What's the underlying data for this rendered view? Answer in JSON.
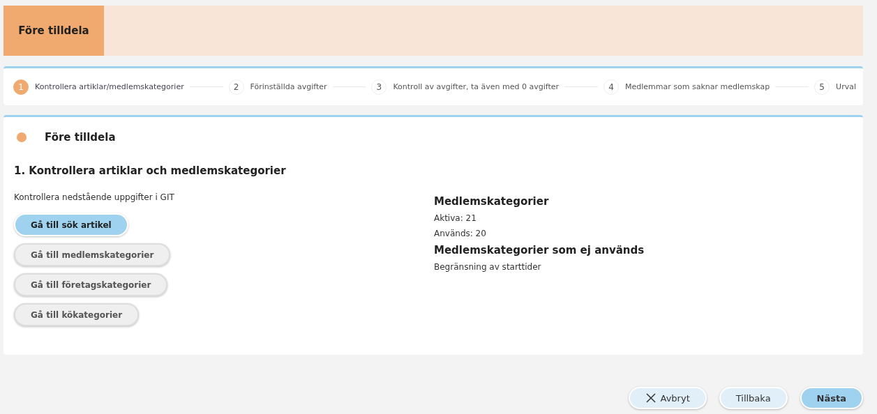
{
  "header": {
    "title": "Före tilldela"
  },
  "steps": [
    {
      "number": "1",
      "label": "Kontrollera artiklar/medlemskategorier",
      "selected": true
    },
    {
      "number": "2",
      "label": "Förinställda avgifter",
      "selected": false
    },
    {
      "number": "3",
      "label": "Kontroll av avgifter, ta även med 0 avgifter",
      "selected": false
    },
    {
      "number": "4",
      "label": "Medlemmar som saknar medlemskap",
      "selected": false
    },
    {
      "number": "5",
      "label": "Urval",
      "selected": false
    }
  ],
  "section": {
    "title": "Före tilldela",
    "heading": "1. Kontrollera artiklar och medlemskategorier",
    "intro": "Kontrollera nedstående uppgifter i GIT",
    "buttons": [
      {
        "label": "Gå till sök artikel",
        "kind": "primary"
      },
      {
        "label": "Gå till medlemskategorier",
        "kind": "secondary"
      },
      {
        "label": "Gå till företagskategorier",
        "kind": "secondary"
      },
      {
        "label": "Gå till kökategorier",
        "kind": "secondary"
      }
    ],
    "info": [
      {
        "kind": "heading",
        "text": "Medlemskategorier"
      },
      {
        "kind": "text",
        "text": "Aktiva: 21"
      },
      {
        "kind": "text",
        "text": "Används: 20"
      },
      {
        "kind": "heading",
        "text": "Medlemskategorier som ej används"
      },
      {
        "kind": "text",
        "text": "Begränsning av starttider"
      }
    ]
  },
  "footer": [
    {
      "label": "Avbryt",
      "kind": "cancel"
    },
    {
      "label": "Tillbaka",
      "kind": "secondary"
    },
    {
      "label": "Nästa",
      "kind": "primary"
    }
  ]
}
